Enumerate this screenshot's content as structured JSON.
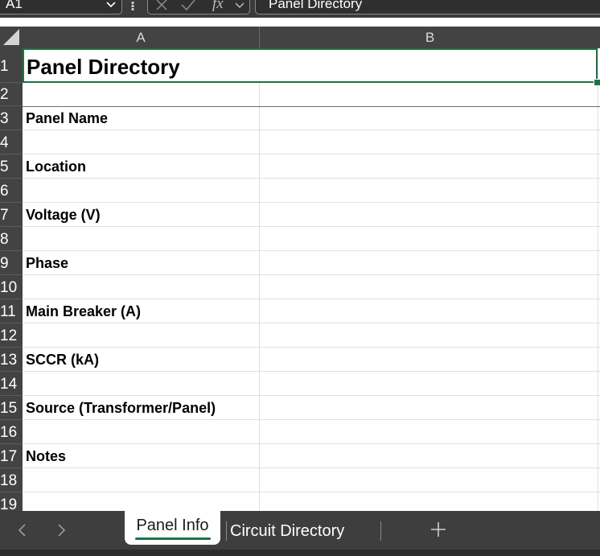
{
  "formula_bar": {
    "name_box": "A1",
    "formula": "Panel Directory",
    "fx_label": "fx"
  },
  "columns": [
    "A",
    "B"
  ],
  "rows": [
    "1",
    "2",
    "3",
    "4",
    "5",
    "6",
    "7",
    "8",
    "9",
    "10",
    "11",
    "12",
    "13",
    "14",
    "15",
    "16",
    "17",
    "18",
    "19"
  ],
  "cells": {
    "a1": "Panel Directory",
    "a3": "Panel Name",
    "a5": "Location",
    "a7": "Voltage (V)",
    "a9": "Phase",
    "a11": "Main Breaker (A)",
    "a13": "SCCR (kA)",
    "a15": "Source (Transformer/Panel)",
    "a17": "Notes"
  },
  "sheets": {
    "active": "Panel Info",
    "other": "Circuit Directory"
  },
  "colors": {
    "accent": "#1e7145",
    "header_bg": "#434343",
    "tabs_bg": "#3e3e3e"
  }
}
